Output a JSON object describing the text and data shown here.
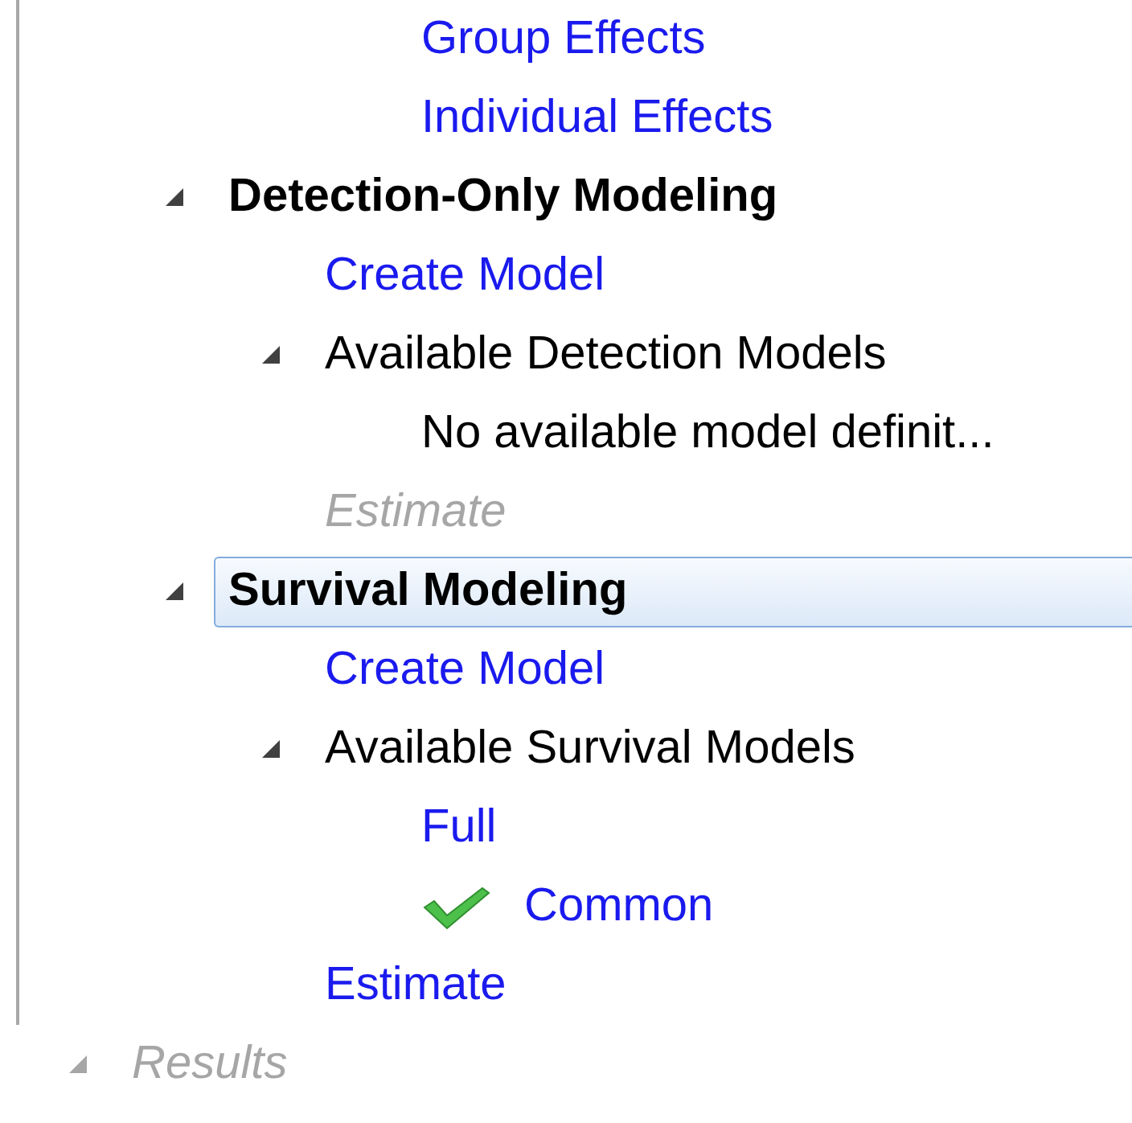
{
  "orphan_items": [
    {
      "label": "Group Effects",
      "kind": "link",
      "selected": false
    },
    {
      "label": "Individual Effects",
      "kind": "link",
      "selected": false
    }
  ],
  "tree": [
    {
      "label": "Detection-Only Modeling",
      "kind": "heading",
      "expanded": true,
      "selected": false,
      "children": [
        {
          "label": "Create Model",
          "kind": "link",
          "selected": false
        },
        {
          "label": "Available Detection Models",
          "kind": "plain",
          "expanded": true,
          "selected": false,
          "children": [
            {
              "label": "No available model definit...",
              "kind": "plain",
              "selected": false
            }
          ]
        },
        {
          "label": "Estimate",
          "kind": "disabled",
          "selected": false
        }
      ]
    },
    {
      "label": "Survival Modeling",
      "kind": "heading",
      "expanded": true,
      "selected": true,
      "children": [
        {
          "label": "Create Model",
          "kind": "link",
          "selected": false
        },
        {
          "label": "Available Survival Models",
          "kind": "plain",
          "expanded": true,
          "selected": false,
          "children": [
            {
              "label": "Full",
              "kind": "link",
              "selected": false,
              "checked": false
            },
            {
              "label": "Common",
              "kind": "link",
              "selected": false,
              "checked": true
            }
          ]
        },
        {
          "label": "Estimate",
          "kind": "link",
          "selected": false
        }
      ]
    }
  ],
  "root_items": [
    {
      "label": "Results",
      "kind": "disabled",
      "expanded": true,
      "selected": false
    }
  ]
}
